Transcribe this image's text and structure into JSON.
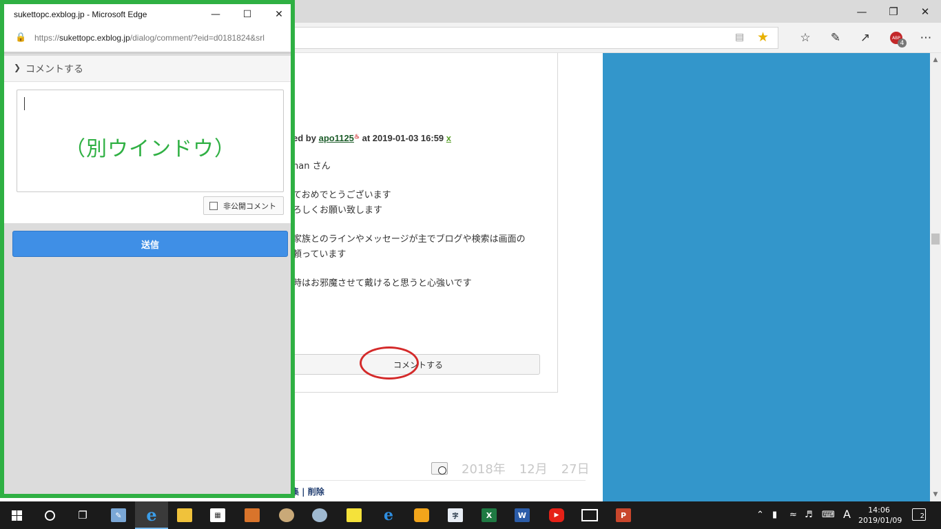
{
  "popup": {
    "title": "sukettopc.exblog.jp - Microsoft Edge",
    "url_prefix": "https://",
    "url_domain": "sukettopc.exblog.jp",
    "url_path": "/dialog/comment/?eid=d0181824&srl",
    "section_label": "コメントする",
    "annotation": "（別ウインドウ）",
    "private_label": "非公開コメント",
    "submit_label": "送信"
  },
  "page": {
    "meta_prefix": "ed by",
    "author": "apo1125",
    "meta_suffix": "at 2019-01-03 16:59",
    "delete_mark": "x",
    "body_lines": [
      "nan さん",
      "ておめでとうございます",
      "ろしくお願い致します",
      "家族とのラインやメッセージが主でブログや検索は画面の",
      "頼っています",
      "時はお邪魔させて戴けると思うと心強いです"
    ],
    "comment_button": "コメントする",
    "date_year": "2018年",
    "date_month": "12月",
    "date_day": "27日",
    "edit_delete": "集 | 削除"
  },
  "toolbar": {
    "abp_label": "ABP",
    "abp_count": "4"
  },
  "taskbar": {
    "time": "14:06",
    "date": "2019/01/09",
    "ime": "A",
    "notifications": "2"
  },
  "colors": {
    "highlight_green": "#2fb043",
    "annotation_red": "#d42a2a",
    "panel_blue": "#3396cb",
    "submit_blue": "#3f8fe6"
  }
}
